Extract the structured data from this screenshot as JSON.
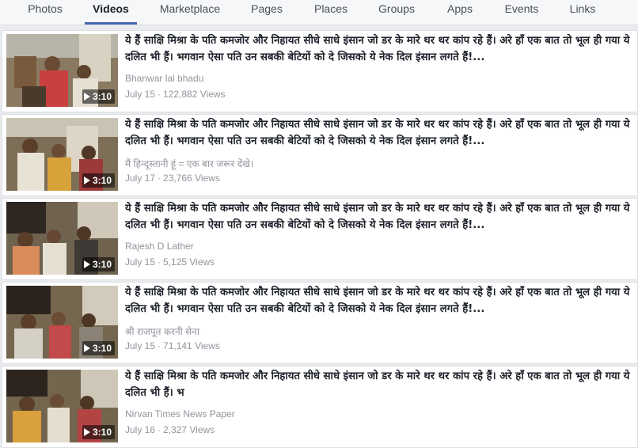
{
  "tabs": [
    {
      "label": "Photos",
      "active": false
    },
    {
      "label": "Videos",
      "active": true
    },
    {
      "label": "Marketplace",
      "active": false
    },
    {
      "label": "Pages",
      "active": false
    },
    {
      "label": "Places",
      "active": false
    },
    {
      "label": "Groups",
      "active": false
    },
    {
      "label": "Apps",
      "active": false
    },
    {
      "label": "Events",
      "active": false
    },
    {
      "label": "Links",
      "active": false
    }
  ],
  "results": [
    {
      "title": "ये हैं साक्षि मिश्रा के पति कमजोर और निहायत सीधे साधे इंसान जो डर के मारे थर थर कांप रहे हैं। अरे हाँ एक बात तो भूल ही गया ये दलित भी हैं। भगवान ऐसा पति उन सबकी बेटियों को दे जिसको ये नेक दिल इंसान लगते हैं!...",
      "author": "Bhanwar lal bhadu",
      "date": "July 15",
      "views": "122,882 Views",
      "duration": "3:10"
    },
    {
      "title": "ये हैं साक्षि मिश्रा के पति कमजोर और निहायत सीधे साधे इंसान जो डर के मारे थर थर कांप रहे हैं। अरे हाँ एक बात तो भूल ही गया ये दलित भी हैं। भगवान ऐसा पति उन सबकी बेटियों को दे जिसको ये नेक दिल इंसान लगते हैं!...",
      "author": "मैं हिन्दूस्तानी हूं = एक बार जरूर देंखे।",
      "date": "July 17",
      "views": "23,766 Views",
      "duration": "3:10"
    },
    {
      "title": "ये हैं साक्षि मिश्रा के पति कमजोर और निहायत सीधे साधे इंसान जो डर के मारे थर थर कांप रहे हैं। अरे हाँ एक बात तो भूल ही गया ये दलित भी हैं। भगवान ऐसा पति उन सबकी बेटियों को दे जिसको ये नेक दिल इंसान लगते हैं!...",
      "author": "Rajesh D Lather",
      "date": "July 15",
      "views": "5,125 Views",
      "duration": "3:10"
    },
    {
      "title": "ये हैं साक्षि मिश्रा के पति कमजोर और निहायत सीधे साधे इंसान जो डर के मारे थर थर कांप रहे हैं। अरे हाँ एक बात तो भूल ही गया ये दलित भी हैं। भगवान ऐसा पति उन सबकी बेटियों को दे जिसको ये नेक दिल इंसान लगते हैं!...",
      "author": "श्री राजपूत करनी सेना",
      "date": "July 15",
      "views": "71,141 Views",
      "duration": "3:10"
    },
    {
      "title": "ये हैं साक्षि मिश्रा के पति कमजोर और निहायत सीधे साधे इंसान जो डर के मारे थर थर कांप रहे हैं। अरे हाँ एक बात तो भूल ही गया ये दलित भी हैं। भ",
      "author": "Nirvan Times News Paper",
      "date": "July 16",
      "views": "2,327 Views",
      "duration": "3:10"
    }
  ],
  "colors": {
    "tab_active_underline": "#4267b2",
    "background": "#e9ebee",
    "meta_text": "#90949c"
  }
}
